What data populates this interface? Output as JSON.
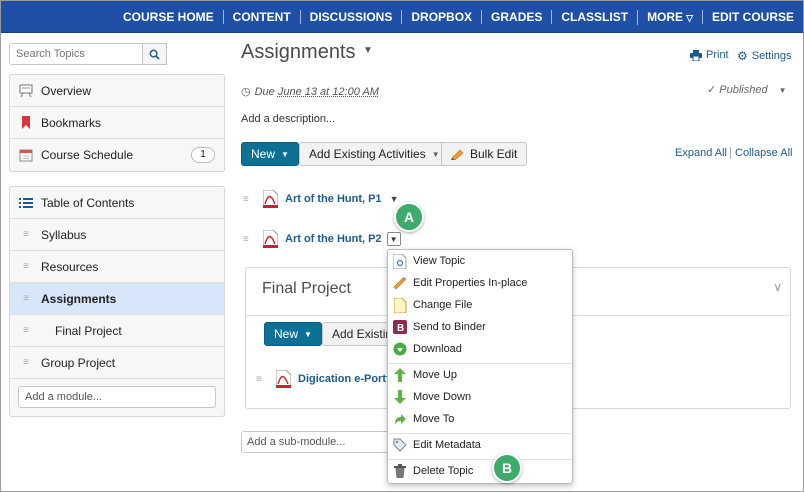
{
  "nav": [
    "COURSE HOME",
    "CONTENT",
    "DISCUSSIONS",
    "DROPBOX",
    "GRADES",
    "CLASSLIST",
    "MORE",
    "EDIT COURSE"
  ],
  "search": {
    "placeholder": "Search Topics"
  },
  "sidebar": {
    "top_items": [
      {
        "label": "Overview",
        "icon": "overview-icon"
      },
      {
        "label": "Bookmarks",
        "icon": "bookmark-icon"
      },
      {
        "label": "Course Schedule",
        "icon": "calendar-icon",
        "badge": "1"
      }
    ],
    "toc_label": "Table of Contents",
    "toc_items": [
      {
        "label": "Syllabus"
      },
      {
        "label": "Resources"
      },
      {
        "label": "Assignments",
        "active": true
      },
      {
        "label": "Final Project",
        "indent": true
      },
      {
        "label": "Group Project"
      }
    ],
    "add_module": "Add a module..."
  },
  "main": {
    "title": "Assignments",
    "print": "Print",
    "settings": "Settings",
    "due_prefix": "Due",
    "due_date": "June 13 at 12:00 AM",
    "published": "Published",
    "description": "Add a description...",
    "new_label": "New",
    "add_existing": "Add Existing Activities",
    "bulk_edit": "Bulk Edit",
    "expand_all": "Expand All",
    "collapse_all": "Collapse All",
    "topics": [
      "Art of the Hunt, P1",
      "Art of the Hunt, P2"
    ],
    "submodule": {
      "title": "Final Project",
      "new_label": "New",
      "add_existing": "Add Existing",
      "topic": "Digication e-Portf"
    },
    "add_submodule": "Add a sub-module..."
  },
  "menu": {
    "group1": [
      "View Topic",
      "Edit Properties In-place",
      "Change File",
      "Send to Binder",
      "Download"
    ],
    "group2": [
      "Move Up",
      "Move Down",
      "Move To"
    ],
    "group3": [
      "Edit Metadata"
    ],
    "group4": [
      "Delete Topic"
    ]
  },
  "callouts": [
    "A",
    "B"
  ],
  "colors": {
    "nav_bg": "#1f4fa6",
    "primary": "#0d7196",
    "link": "#1a5a8e",
    "active_bg": "#d7e7f9",
    "callout": "#3cab6b"
  }
}
